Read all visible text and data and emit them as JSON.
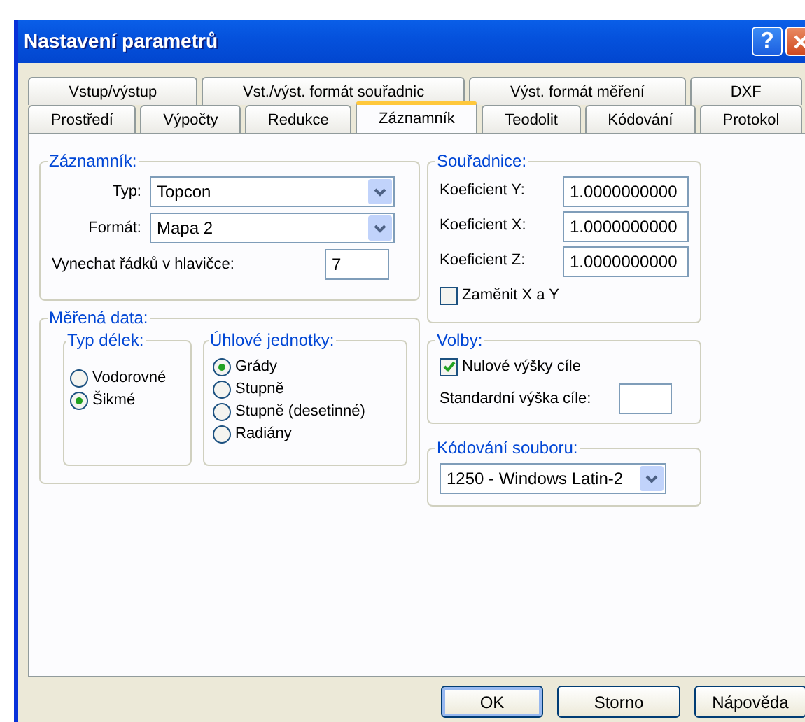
{
  "window": {
    "title": "Nastavení parametrů",
    "help_button": "?"
  },
  "tabs": [
    [
      {
        "label": "Vstup/výstup",
        "selected": false
      },
      {
        "label": "Vst./výst. formát souřadnic",
        "selected": false
      },
      {
        "label": "Výst. formát měření",
        "selected": false
      },
      {
        "label": "DXF",
        "selected": false
      }
    ],
    [
      {
        "label": "Prostředí",
        "selected": false
      },
      {
        "label": "Výpočty",
        "selected": false
      },
      {
        "label": "Redukce",
        "selected": false
      },
      {
        "label": "Záznamník",
        "selected": true
      },
      {
        "label": "Teodolit",
        "selected": false
      },
      {
        "label": "Kódování",
        "selected": false
      },
      {
        "label": "Protokol",
        "selected": false
      }
    ]
  ],
  "zaznamnik": {
    "title": "Záznamník:",
    "fields": [
      {
        "kind": "select",
        "label": "Typ:",
        "value": "Topcon"
      },
      {
        "kind": "select",
        "label": "Formát:",
        "value": "Mapa 2"
      },
      {
        "kind": "input",
        "label": "Vynechat řádků v hlavičce:",
        "value": "7"
      }
    ]
  },
  "merena_data": {
    "title": "Měřená data:",
    "groups": [
      {
        "title": "Typ délek:",
        "options": [
          {
            "label": "Vodorovné",
            "selected": false
          },
          {
            "label": "Šikmé",
            "selected": true
          }
        ]
      },
      {
        "title": "Úhlové jednotky:",
        "options": [
          {
            "label": "Grády",
            "selected": true
          },
          {
            "label": "Stupně",
            "selected": false
          },
          {
            "label": "Stupně (desetinné)",
            "selected": false
          },
          {
            "label": "Radiány",
            "selected": false
          }
        ]
      }
    ]
  },
  "souradnice": {
    "title": "Souřadnice:",
    "fields": [
      {
        "kind": "input",
        "label": "Koeficient Y:",
        "value": "1.0000000000"
      },
      {
        "kind": "input",
        "label": "Koeficient X:",
        "value": "1.0000000000"
      },
      {
        "kind": "input",
        "label": "Koeficient Z:",
        "value": "1.0000000000"
      },
      {
        "kind": "checkbox",
        "label": "Zaměnit X a Y",
        "checked": false
      }
    ]
  },
  "volby": {
    "title": "Volby:",
    "fields": [
      {
        "kind": "checkbox",
        "label": "Nulové výšky cíle",
        "checked": true
      },
      {
        "kind": "input",
        "label": "Standardní výška cíle:"
      }
    ]
  },
  "kodovani": {
    "title": "Kódování souboru:",
    "fields": [
      {
        "kind": "select",
        "value": "1250 - Windows Latin-2"
      }
    ]
  },
  "buttons": [
    {
      "label": "OK",
      "default": true
    },
    {
      "label": "Storno",
      "default": false
    },
    {
      "label": "Nápověda",
      "default": false
    }
  ]
}
